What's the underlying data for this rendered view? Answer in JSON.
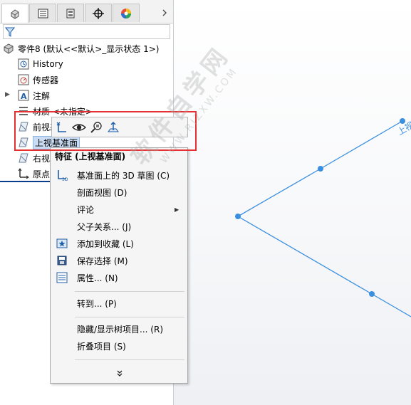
{
  "tabs": [
    {
      "name": "feature-manager",
      "icon": "feature-tree-icon",
      "active": true
    },
    {
      "name": "property-manager",
      "icon": "property-list-icon",
      "active": false
    },
    {
      "name": "configuration-manager",
      "icon": "configuration-icon",
      "active": false
    },
    {
      "name": "dim-xpert",
      "icon": "crosshair-icon",
      "active": false
    },
    {
      "name": "display-manager",
      "icon": "color-wheel-icon",
      "active": false
    }
  ],
  "tree": {
    "root_label": "零件8  (默认<<默认>_显示状态 1>)",
    "items": [
      {
        "label": "History",
        "icon": "history-icon"
      },
      {
        "label": "传感器",
        "icon": "sensor-icon"
      },
      {
        "label": "注解",
        "icon": "annotation-icon"
      },
      {
        "label": "材质 <未指定>",
        "icon": "material-icon"
      },
      {
        "label": "前视基准面",
        "icon": "plane-icon"
      },
      {
        "label": "上视基准面",
        "icon": "plane-icon",
        "selected": true
      },
      {
        "label": "右视基准面",
        "icon": "plane-icon"
      },
      {
        "label": "原点",
        "icon": "origin-icon"
      }
    ]
  },
  "toolbar": {
    "buttons": [
      {
        "name": "sketch-button",
        "icon": "sketch-icon"
      },
      {
        "name": "show-hide-button",
        "icon": "eye-icon"
      },
      {
        "name": "zoom-to-selection-button",
        "icon": "zoom-icon"
      },
      {
        "name": "normal-to-button",
        "icon": "normal-to-icon"
      }
    ]
  },
  "context_menu": {
    "header": "特征 (上视基准面)",
    "items": [
      {
        "label": "基准面上的 3D 草图 (C)",
        "icon": "sketch3d-icon"
      },
      {
        "label": "剖面视图 (D)",
        "icon": ""
      },
      {
        "label": "评论",
        "icon": "",
        "submenu": true
      },
      {
        "label": "父子关系... (J)",
        "icon": ""
      },
      {
        "label": "添加到收藏 (L)",
        "icon": "favorite-icon"
      },
      {
        "label": "保存选择 (M)",
        "icon": "save-selection-icon"
      },
      {
        "label": "属性... (N)",
        "icon": "properties-icon"
      },
      {
        "label": "转到... (P)",
        "icon": ""
      },
      {
        "label": "隐藏/显示树项目... (R)",
        "icon": ""
      },
      {
        "label": "折叠项目 (S)",
        "icon": ""
      }
    ],
    "more_icon": "expand-more-icon"
  },
  "watermark": {
    "line1": "软件自学网",
    "line2": "WWW.RJZXW.COM"
  },
  "viewport": {
    "plane_label": "上视"
  },
  "colors": {
    "accent": "#3b8fe0",
    "highlight": "#c9dcf3",
    "annotation_red": "#e53030"
  }
}
